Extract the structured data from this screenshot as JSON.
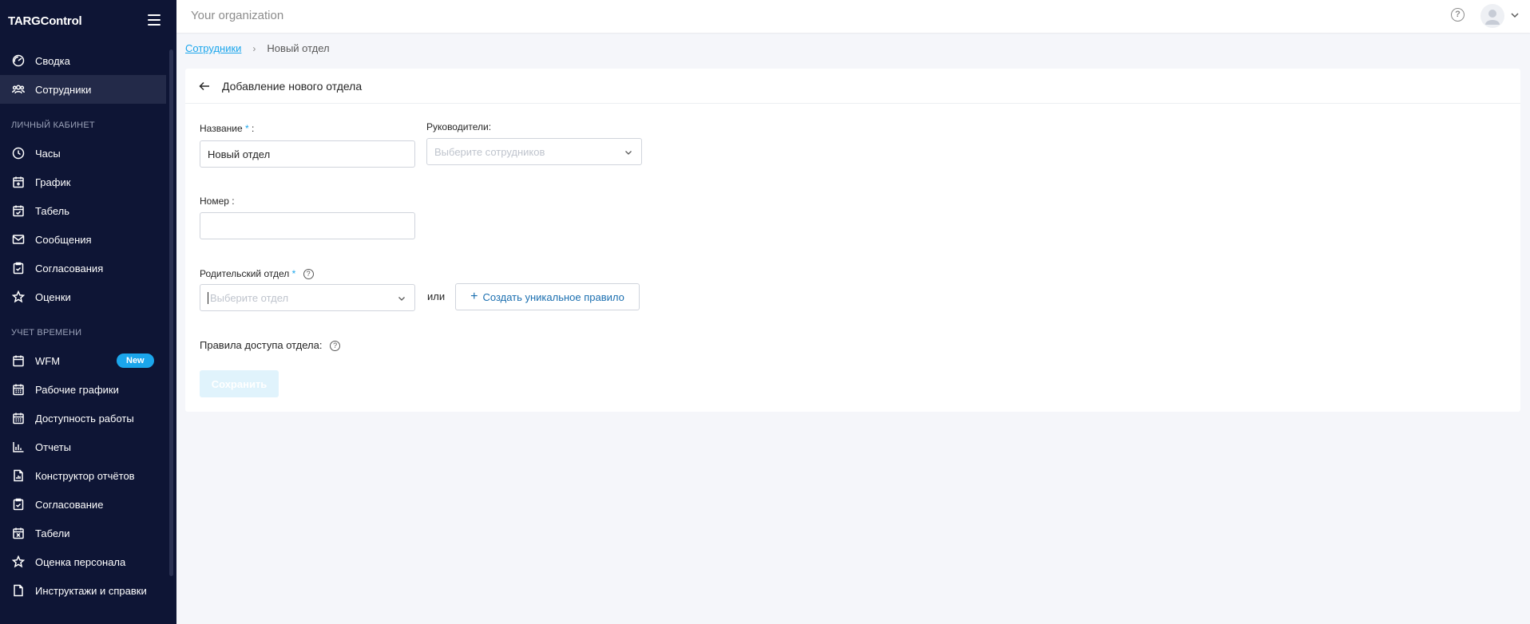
{
  "app": {
    "brand": "TARGControl",
    "organization": "Your organization"
  },
  "sidebar": {
    "items_top": [
      {
        "label": "Сводка",
        "icon": "dashboard-icon"
      },
      {
        "label": "Сотрудники",
        "icon": "users-icon",
        "active": true
      }
    ],
    "section_personal": "ЛИЧНЫЙ КАБИНЕТ",
    "items_personal": [
      {
        "label": "Часы",
        "icon": "clock-icon"
      },
      {
        "label": "График",
        "icon": "calendar-add-icon"
      },
      {
        "label": "Табель",
        "icon": "calendar-check-icon"
      },
      {
        "label": "Сообщения",
        "icon": "mail-icon"
      },
      {
        "label": "Согласования",
        "icon": "clipboard-check-icon"
      },
      {
        "label": "Оценки",
        "icon": "star-icon"
      }
    ],
    "section_time": "УЧЕТ ВРЕМЕНИ",
    "items_time": [
      {
        "label": "WFM",
        "icon": "calendar-icon",
        "badge": "New"
      },
      {
        "label": "Рабочие графики",
        "icon": "calendar-grid-icon"
      },
      {
        "label": "Доступность работы",
        "icon": "calendar-grid-icon"
      },
      {
        "label": "Отчеты",
        "icon": "bar-chart-icon"
      },
      {
        "label": "Конструктор отчётов",
        "icon": "file-chart-icon"
      },
      {
        "label": "Согласование",
        "icon": "clipboard-check-icon"
      },
      {
        "label": "Табели",
        "icon": "calendar-x-icon"
      },
      {
        "label": "Оценка персонала",
        "icon": "star-icon"
      },
      {
        "label": "Инструктажи и справки",
        "icon": "document-icon"
      }
    ]
  },
  "breadcrumb": {
    "parent": "Сотрудники",
    "separator": "›",
    "current": "Новый отдел"
  },
  "form": {
    "title": "Добавление нового отдела",
    "name_label": "Название",
    "required_mark": "*",
    "colon": ":",
    "name_value": "Новый отдел",
    "managers_label": "Руководители:",
    "managers_placeholder": "Выберите сотрудников",
    "number_label": "Номер :",
    "number_value": "",
    "parent_label": "Родительский отдел",
    "parent_placeholder": "Выберите отдел",
    "or_text": "или",
    "create_rule_button": "Создать уникальное правило",
    "access_rules_label": "Правила доступа отдела:",
    "help_glyph": "?",
    "save_button": "Сохранить"
  },
  "colors": {
    "sidebar_bg": "#0e1535",
    "accent": "#1ba6ec",
    "badge_bg": "#1ba6ec"
  }
}
